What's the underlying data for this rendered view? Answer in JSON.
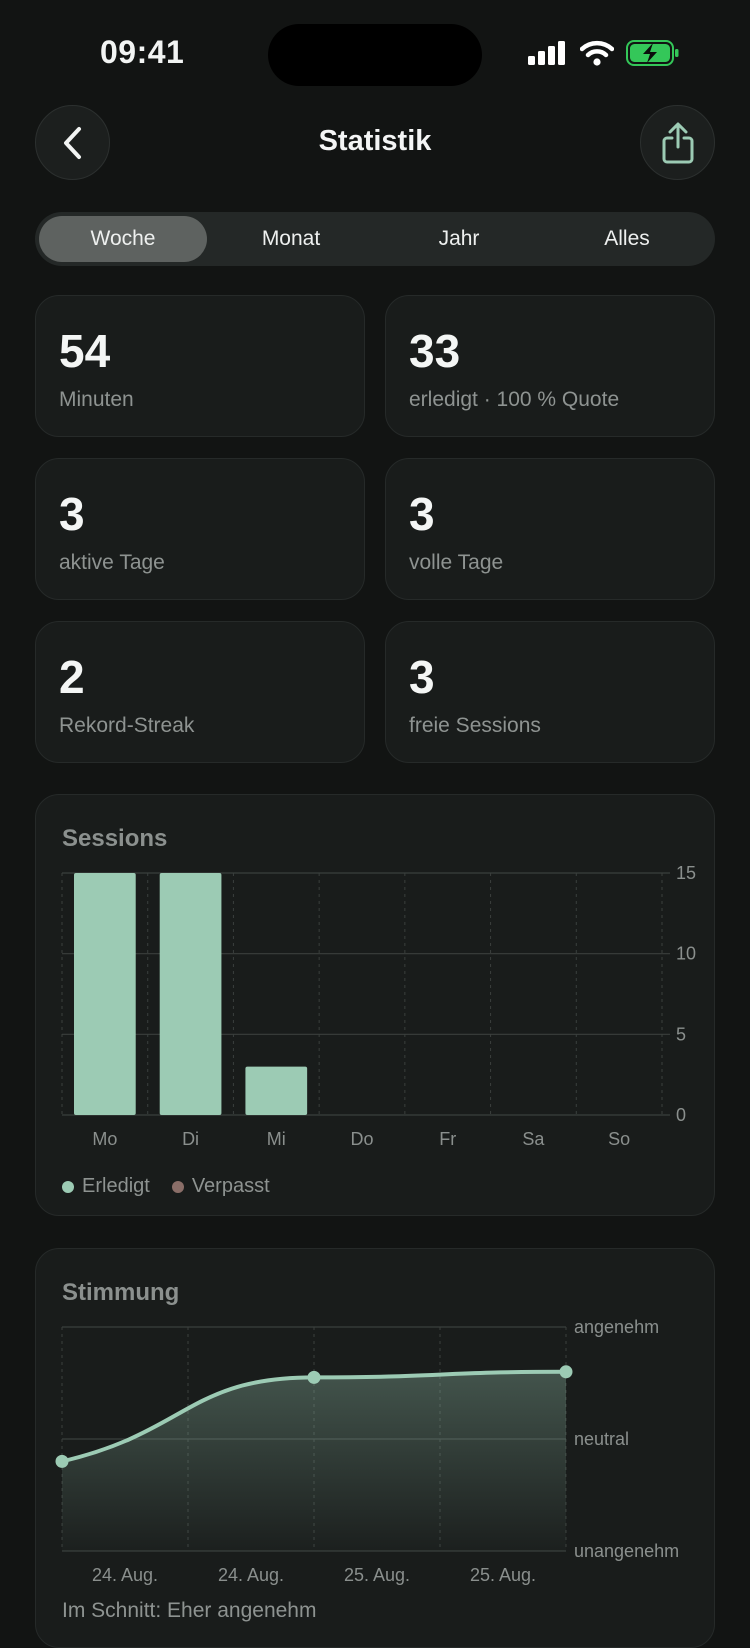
{
  "status": {
    "time": "09:41"
  },
  "header": {
    "title": "Statistik"
  },
  "tabs": [
    {
      "label": "Woche",
      "active": true
    },
    {
      "label": "Monat",
      "active": false
    },
    {
      "label": "Jahr",
      "active": false
    },
    {
      "label": "Alles",
      "active": false
    }
  ],
  "stats": [
    {
      "value": "54",
      "label": "Minuten"
    },
    {
      "value": "33",
      "label": "erledigt · 100 % Quote"
    },
    {
      "value": "3",
      "label": "aktive Tage"
    },
    {
      "value": "3",
      "label": "volle Tage"
    },
    {
      "value": "2",
      "label": "Rekord-Streak"
    },
    {
      "value": "3",
      "label": "freie Sessions"
    }
  ],
  "sessions": {
    "title": "Sessions",
    "legend": [
      {
        "label": "Erledigt",
        "color": "#9ccbb4"
      },
      {
        "label": "Verpasst",
        "color": "#8a6e68"
      }
    ]
  },
  "mood": {
    "title": "Stimmung",
    "summary": "Im Schnitt: Eher angenehm"
  },
  "colors": {
    "accent": "#9ccbb4",
    "background": "#121413",
    "battery": "#34c759"
  },
  "chart_data": [
    {
      "type": "bar",
      "title": "Sessions",
      "categories": [
        "Mo",
        "Di",
        "Mi",
        "Do",
        "Fr",
        "Sa",
        "So"
      ],
      "series": [
        {
          "name": "Erledigt",
          "values": [
            15,
            15,
            3,
            0,
            0,
            0,
            0
          ]
        },
        {
          "name": "Verpasst",
          "values": [
            0,
            0,
            0,
            0,
            0,
            0,
            0
          ]
        }
      ],
      "yticks": [
        0,
        5,
        10,
        15
      ],
      "ylim": [
        0,
        15
      ],
      "grid": true,
      "legend": "bottom-left"
    },
    {
      "type": "line",
      "title": "Stimmung",
      "x_labels": [
        "24. Aug.",
        "24. Aug.",
        "25. Aug.",
        "25. Aug."
      ],
      "y_levels": [
        "unangenehm",
        "neutral",
        "angenehm"
      ],
      "ylim": [
        0,
        2
      ],
      "points": [
        {
          "x": 0,
          "y": 0.8
        },
        {
          "x": 2,
          "y": 1.55
        },
        {
          "x": 4,
          "y": 1.6
        }
      ],
      "xlim": [
        0,
        4
      ],
      "grid": true
    }
  ]
}
